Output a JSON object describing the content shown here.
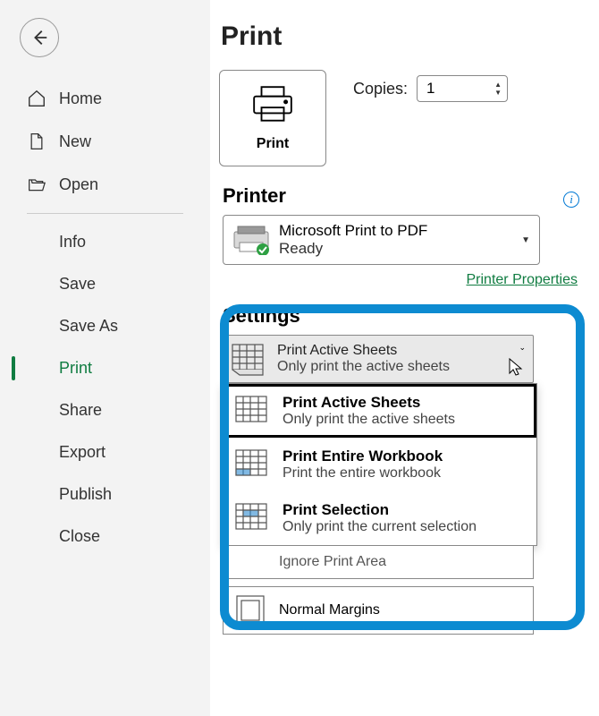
{
  "sidebar": {
    "items": [
      {
        "label": "Home"
      },
      {
        "label": "New"
      },
      {
        "label": "Open"
      },
      {
        "label": "Info"
      },
      {
        "label": "Save"
      },
      {
        "label": "Save As"
      },
      {
        "label": "Print"
      },
      {
        "label": "Share"
      },
      {
        "label": "Export"
      },
      {
        "label": "Publish"
      },
      {
        "label": "Close"
      }
    ]
  },
  "main": {
    "title": "Print",
    "print_button_label": "Print",
    "copies_label": "Copies:",
    "copies_value": "1",
    "printer_header": "Printer",
    "printer_name": "Microsoft Print to PDF",
    "printer_status": "Ready",
    "printer_properties": "Printer Properties",
    "settings_header": "Settings",
    "dropdown": {
      "title": "Print Active Sheets",
      "sub": "Only print the active sheets"
    },
    "options": [
      {
        "title": "Print Active Sheets",
        "desc": "Only print the active sheets"
      },
      {
        "title": "Print Entire Workbook",
        "desc": "Print the entire workbook"
      },
      {
        "title": "Print Selection",
        "desc": "Only print the current selection"
      }
    ],
    "ignore_area": "Ignore Print Area",
    "margins": "Normal Margins"
  }
}
